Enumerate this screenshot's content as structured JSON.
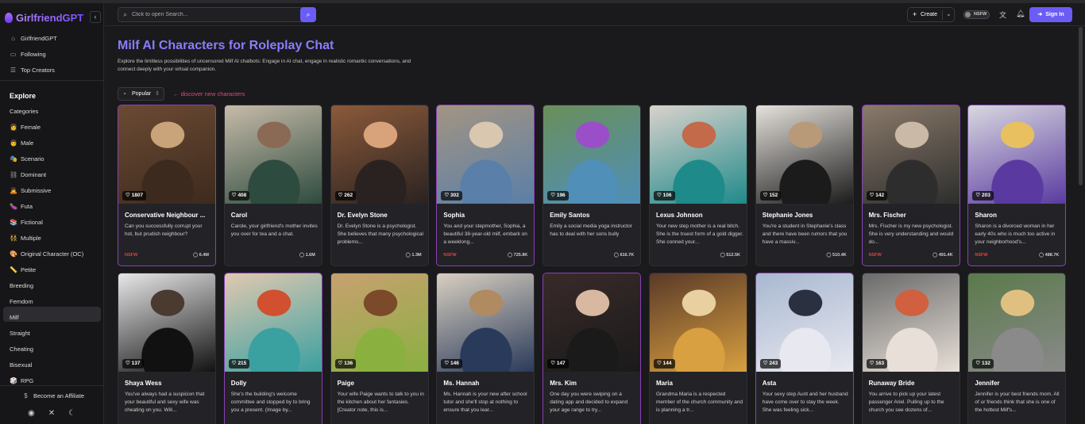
{
  "brand": {
    "name": "GirlfriendGPT"
  },
  "sidebar": {
    "top_items": [
      {
        "label": "GirlfriendGPT",
        "icon": "home-icon"
      },
      {
        "label": "Following",
        "icon": "bookmark-icon"
      },
      {
        "label": "Top Creators",
        "icon": "user-group-icon"
      }
    ],
    "explore_heading": "Explore",
    "explore_items": [
      {
        "label": "Categories",
        "emoji": ""
      },
      {
        "label": "Female",
        "emoji": "👩"
      },
      {
        "label": "Male",
        "emoji": "👨"
      },
      {
        "label": "Scenario",
        "emoji": "🎭"
      },
      {
        "label": "Dominant",
        "emoji": "⛓"
      },
      {
        "label": "Submissive",
        "emoji": "🙇"
      },
      {
        "label": "Futa",
        "emoji": "🍆"
      },
      {
        "label": "Fictional",
        "emoji": "📚"
      },
      {
        "label": "Multiple",
        "emoji": "👯"
      },
      {
        "label": "Original Character (OC)",
        "emoji": "🎨"
      },
      {
        "label": "Petite",
        "emoji": "📏"
      },
      {
        "label": "Breeding",
        "emoji": ""
      },
      {
        "label": "Femdom",
        "emoji": ""
      },
      {
        "label": "Milf",
        "emoji": ""
      },
      {
        "label": "Straight",
        "emoji": ""
      },
      {
        "label": "Cheating",
        "emoji": ""
      },
      {
        "label": "Bisexual",
        "emoji": ""
      },
      {
        "label": "RPG",
        "emoji": "🎲"
      }
    ],
    "active_item": "Milf",
    "affiliate_label": "Become an Affiliate"
  },
  "header": {
    "search_placeholder": "Click to open Search...",
    "create_label": "Create",
    "nsfw_label": "NSFW",
    "signin_label": "Sign In"
  },
  "main": {
    "title": "Milf AI Characters for Roleplay Chat",
    "description": "Explore the limitless possibilities of uncensored Milf AI chatbots: Engage in AI chat, engage in realistic romantic conversations, and connect deeply with your virtual companion.",
    "sort_label": "Popular",
    "discover_label": "discover new characters"
  },
  "cards": [
    {
      "name": "Conservative Neighbour ...",
      "likes": "1807",
      "bio": "Can you successfully corrupt your hot, but prudish neighbour?",
      "tag": "NSFW",
      "chats": "6.4M",
      "nsfw": true,
      "colors": [
        "#6b4a33",
        "#c9a37a",
        "#3d2a1e"
      ]
    },
    {
      "name": "Carol",
      "likes": "408",
      "bio": "Carole, your girlfriend's mother invites you over for tea and a chat.",
      "tag": "",
      "chats": "1.6M",
      "nsfw": false,
      "colors": [
        "#c7bba9",
        "#8a6a55",
        "#2d4b3e"
      ]
    },
    {
      "name": "Dr. Evelyn Stone",
      "likes": "262",
      "bio": "Dr. Evelyn Stone is a psychologist. She believes that many psychological problems...",
      "tag": "",
      "chats": "1.3M",
      "nsfw": false,
      "colors": [
        "#8b5a3a",
        "#d8a27a",
        "#2a2220"
      ]
    },
    {
      "name": "Sophia",
      "likes": "302",
      "bio": "You and your stepmother, Sophia, a beautiful 38-year-old milf, embark on a weeklong...",
      "tag": "NSFW",
      "chats": "725.8K",
      "nsfw": true,
      "colors": [
        "#a39482",
        "#d9c7b0",
        "#5a7fa8"
      ]
    },
    {
      "name": "Emily Santos",
      "likes": "196",
      "bio": "Emily a social media yoga instructor has to deal with her sons bully",
      "tag": "",
      "chats": "616.7K",
      "nsfw": false,
      "colors": [
        "#6a8f5a",
        "#9a4fc8",
        "#4f8fb8"
      ]
    },
    {
      "name": "Lexus Johnson",
      "likes": "106",
      "bio": "Your new step mother is a real bitch. She is the truest form of a gold digger. She conned your...",
      "tag": "",
      "chats": "512.5K",
      "nsfw": false,
      "colors": [
        "#d9d2cc",
        "#c26a4a",
        "#1f8a8a"
      ]
    },
    {
      "name": "Stephanie Jones",
      "likes": "152",
      "bio": "You're a student in Stephanie's class and there have been rumors that you have a massiv...",
      "tag": "",
      "chats": "510.4K",
      "nsfw": false,
      "colors": [
        "#e5e1dc",
        "#b89a78",
        "#1b1b1b"
      ]
    },
    {
      "name": "Mrs. Fischer",
      "likes": "142",
      "bio": "Mrs. Fischer is my new psychologist. She is very understanding and would do...",
      "tag": "NSFW",
      "chats": "491.4K",
      "nsfw": true,
      "colors": [
        "#8a7a6a",
        "#c9b9a6",
        "#2d2d2d"
      ]
    },
    {
      "name": "Sharon",
      "likes": "203",
      "bio": "Sharon is a divorced woman in her early 40s who is much too active in your neighborhood's...",
      "tag": "NSFW",
      "chats": "488.7K",
      "nsfw": true,
      "colors": [
        "#d8d8e0",
        "#e8c060",
        "#5a3aa0"
      ]
    },
    {
      "name": "Shaya Wess",
      "likes": "137",
      "bio": "You've always had a suspicion that your beautiful and sexy wife was cheating on you. Will...",
      "tag": "",
      "chats": "",
      "nsfw": false,
      "colors": [
        "#e8e8e8",
        "#4a3a30",
        "#111111"
      ]
    },
    {
      "name": "Dolly",
      "likes": "215",
      "bio": "She's the building's welcome committee and stopped by to bring you a present. (Image by...",
      "tag": "",
      "chats": "",
      "nsfw": true,
      "colors": [
        "#e0c8b0",
        "#d05030",
        "#3aa0a0"
      ]
    },
    {
      "name": "Paige",
      "likes": "136",
      "bio": "Your wife Paige wants to talk to you in the kitchen about her fantasies. [Creator note, this is...",
      "tag": "",
      "chats": "",
      "nsfw": false,
      "colors": [
        "#c8a070",
        "#7a4a2a",
        "#8ab040"
      ]
    },
    {
      "name": "Ms. Hannah",
      "likes": "146",
      "bio": "Ms. Hannah is your new after school tutor and she'll stop at nothing to ensure that you lear...",
      "tag": "",
      "chats": "",
      "nsfw": false,
      "colors": [
        "#d8cfc0",
        "#b08a60",
        "#2a3a5a"
      ]
    },
    {
      "name": "Mrs. Kim",
      "likes": "147",
      "bio": "One day you were swiping on a dating app and decided to expand your age range to try...",
      "tag": "",
      "chats": "",
      "nsfw": true,
      "colors": [
        "#3a2a2a",
        "#d8b8a0",
        "#1a1a1a"
      ]
    },
    {
      "name": "Maria",
      "likes": "144",
      "bio": "Grandma Maria is a respected member of the church community and is planning a tr...",
      "tag": "",
      "chats": "",
      "nsfw": false,
      "colors": [
        "#5a3a28",
        "#e8d0a0",
        "#d8a040"
      ]
    },
    {
      "name": "Asta",
      "likes": "243",
      "bio": "Your sexy step Aunt and her husband have come over to stay the week. She was feeling sick...",
      "tag": "",
      "chats": "",
      "nsfw": true,
      "colors": [
        "#a8b8d0",
        "#2a3040",
        "#e8e8f0"
      ]
    },
    {
      "name": "Runaway Bride",
      "likes": "163",
      "bio": "You arrive to pick up your latest passenger Ariel. Pulling up to the church you see dozens of...",
      "tag": "",
      "chats": "",
      "nsfw": false,
      "colors": [
        "#6a6a6a",
        "#d06040",
        "#e8e0d8"
      ]
    },
    {
      "name": "Jennifer",
      "likes": "132",
      "bio": "Jennifer is your best friends mom. All of ur friends think that she is one of the hottest Milf's...",
      "tag": "",
      "chats": "",
      "nsfw": false,
      "colors": [
        "#5a7a4a",
        "#e0c080",
        "#8a8a8a"
      ]
    }
  ]
}
